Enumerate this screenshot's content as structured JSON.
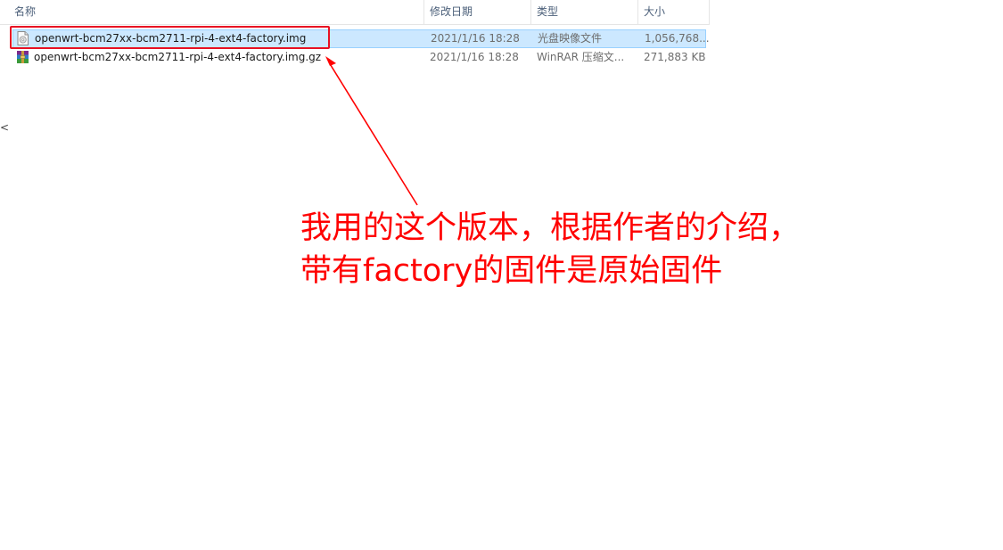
{
  "columns": {
    "name": "名称",
    "date": "修改日期",
    "type": "类型",
    "size": "大小"
  },
  "files": [
    {
      "name": "openwrt-bcm27xx-bcm2711-rpi-4-ext4-factory.img",
      "date": "2021/1/16 18:28",
      "type": "光盘映像文件",
      "size": "1,056,768...",
      "icon": "disc-image-icon",
      "selected": true
    },
    {
      "name": "openwrt-bcm27xx-bcm2711-rpi-4-ext4-factory.img.gz",
      "date": "2021/1/16 18:28",
      "type": "WinRAR 压缩文...",
      "size": "271,883 KB",
      "icon": "winrar-archive-icon",
      "selected": false
    }
  ],
  "annotation": {
    "line1": "我用的这个版本，根据作者的介绍，",
    "line2": "带有factory的固件是原始固件",
    "color": "#ff0000"
  },
  "colors": {
    "selection_bg": "#cce8ff",
    "selection_border": "#99d1ff",
    "highlight_box": "#e81123"
  }
}
